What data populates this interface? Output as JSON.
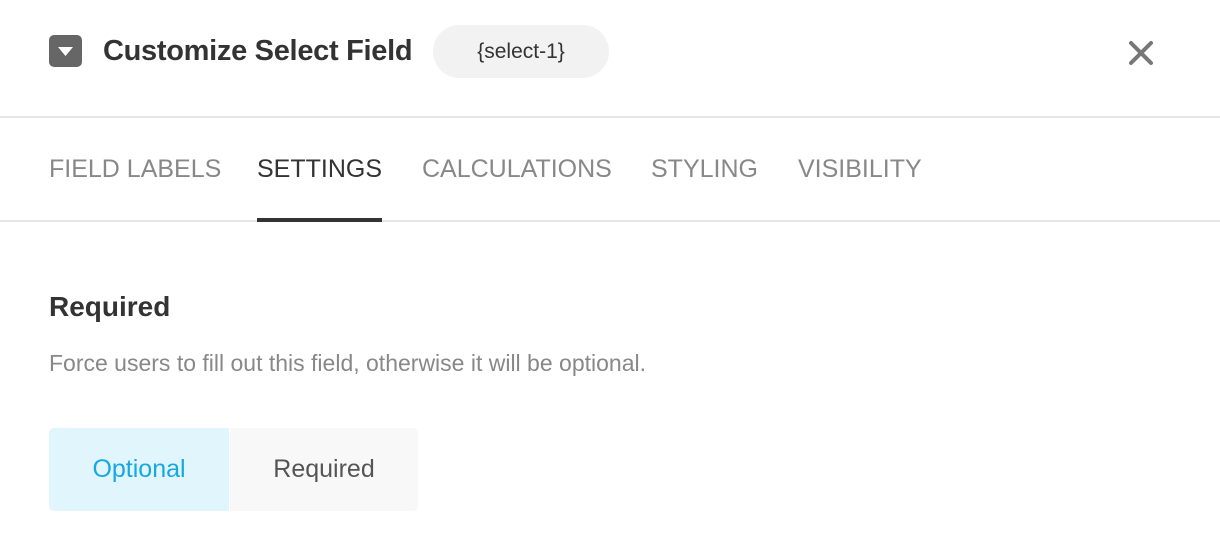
{
  "header": {
    "title": "Customize Select Field",
    "field_tag": "{select-1}",
    "field_icon": "select-dropdown-icon",
    "close_icon": "close-icon"
  },
  "tabs": [
    {
      "label": "FIELD LABELS",
      "active": false
    },
    {
      "label": "SETTINGS",
      "active": true
    },
    {
      "label": "CALCULATIONS",
      "active": false
    },
    {
      "label": "STYLING",
      "active": false
    },
    {
      "label": "VISIBILITY",
      "active": false
    }
  ],
  "required_section": {
    "title": "Required",
    "description": "Force users to fill out this field, otherwise it will be optional.",
    "options": [
      {
        "label": "Optional",
        "selected": true
      },
      {
        "label": "Required",
        "selected": false
      }
    ]
  },
  "colors": {
    "accent": "#17a8e3",
    "selected_bg": "#e1f5fd",
    "text_dark": "#333333",
    "text_muted": "#888888"
  }
}
